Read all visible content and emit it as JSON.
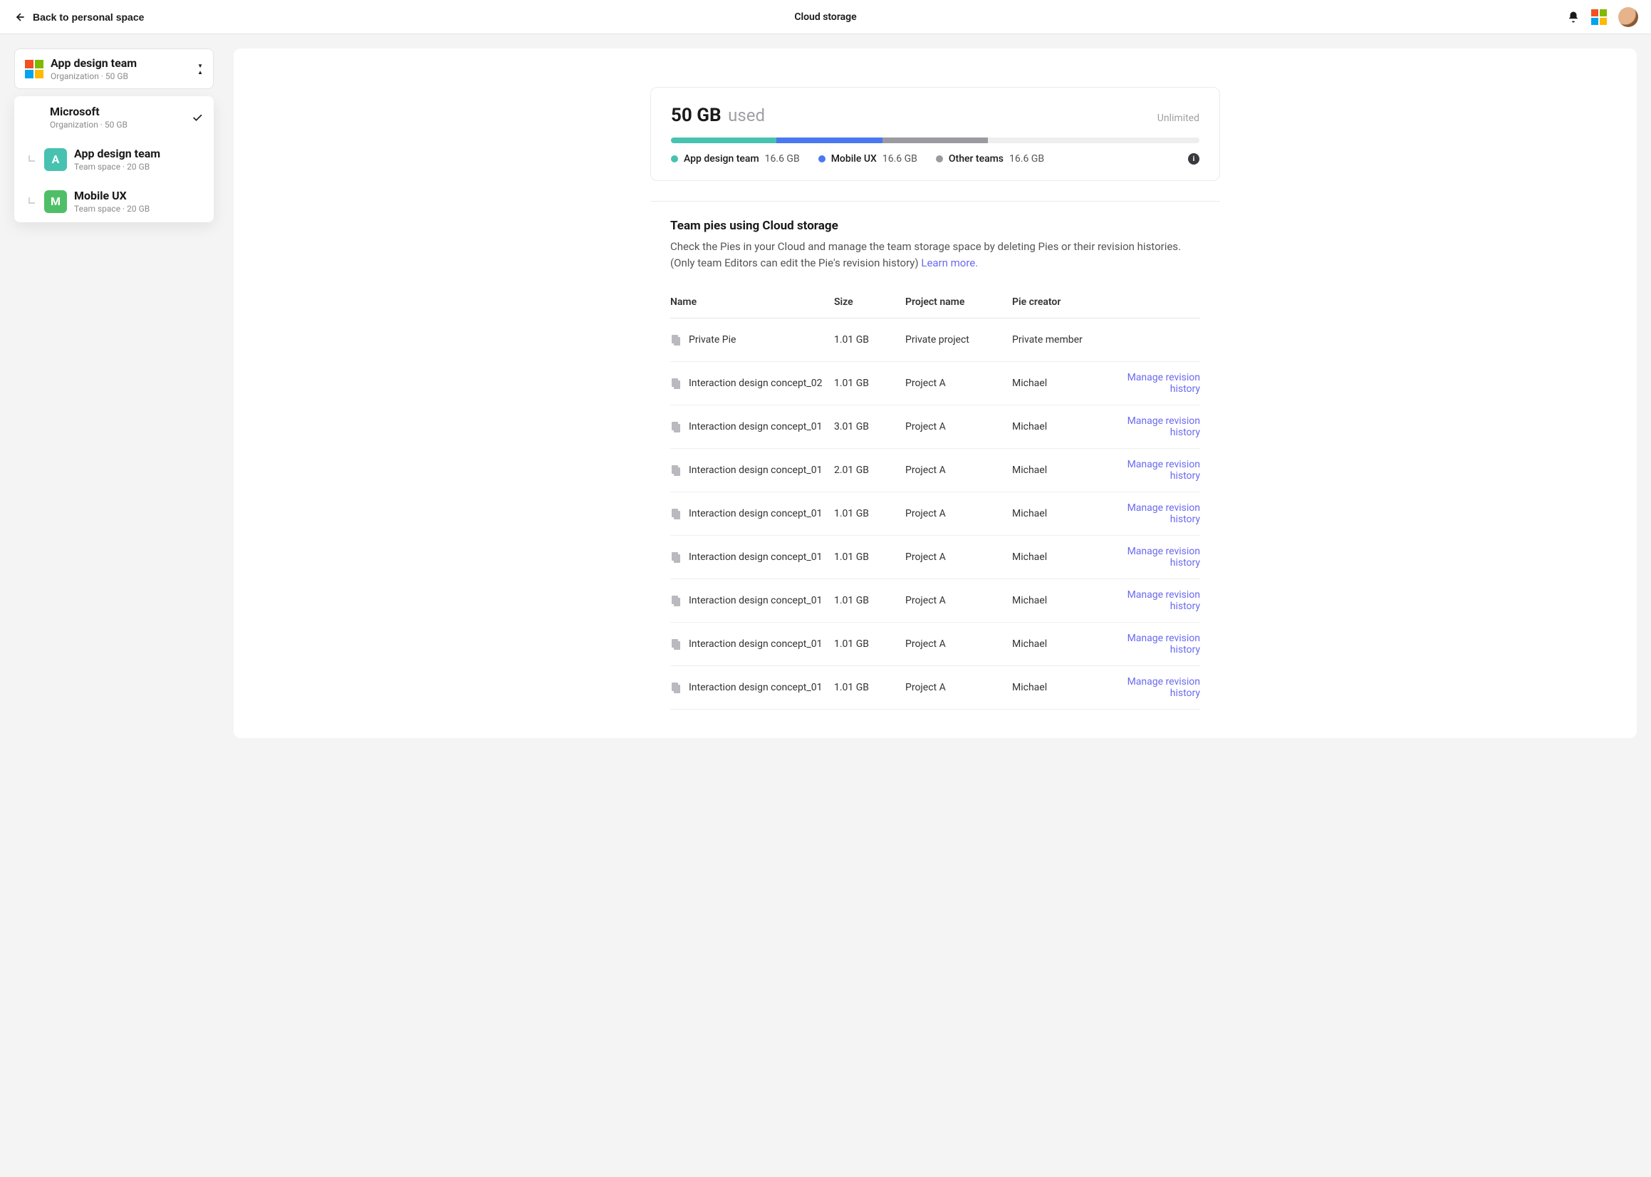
{
  "header": {
    "back_label": "Back to personal space",
    "title": "Cloud storage"
  },
  "sidebar": {
    "selected": {
      "title": "App design team",
      "subtitle": "Organization · 50 GB"
    },
    "dropdown": {
      "org": {
        "title": "Microsoft",
        "subtitle": "Organization · 50 GB"
      },
      "teams": [
        {
          "letter": "A",
          "title": "App design team",
          "subtitle": "Team space · 20 GB",
          "color": "cyan"
        },
        {
          "letter": "M",
          "title": "Mobile UX",
          "subtitle": "Team space · 20 GB",
          "color": "green"
        }
      ]
    }
  },
  "storage": {
    "amount": "50 GB",
    "used_label": "used",
    "cap_label": "Unlimited",
    "segments": [
      {
        "name": "App design team",
        "value": "16.6 GB",
        "pct": 20
      },
      {
        "name": "Mobile UX",
        "value": "16.6 GB",
        "pct": 20
      },
      {
        "name": "Other teams",
        "value": "16.6 GB",
        "pct": 20
      }
    ]
  },
  "pies": {
    "heading": "Team pies using Cloud storage",
    "description": "Check the Pies in your Cloud and manage the team storage space by deleting Pies or their revision histories. (Only team Editors can edit the Pie's revision history) ",
    "learn_more": "Learn more.",
    "columns": {
      "name": "Name",
      "size": "Size",
      "project": "Project name",
      "creator": "Pie creator"
    },
    "action_label": "Manage revision history",
    "rows": [
      {
        "name": "Private Pie",
        "size": "1.01 GB",
        "project": "Private project",
        "creator": "Private member",
        "private": true
      },
      {
        "name": "Interaction design concept_02",
        "size": "1.01 GB",
        "project": "Project A",
        "creator": "Michael"
      },
      {
        "name": "Interaction design concept_01",
        "size": "3.01 GB",
        "project": "Project A",
        "creator": "Michael"
      },
      {
        "name": "Interaction design concept_01",
        "size": "2.01 GB",
        "project": "Project A",
        "creator": "Michael"
      },
      {
        "name": "Interaction design concept_01",
        "size": "1.01 GB",
        "project": "Project A",
        "creator": "Michael"
      },
      {
        "name": "Interaction design concept_01",
        "size": "1.01 GB",
        "project": "Project A",
        "creator": "Michael"
      },
      {
        "name": "Interaction design concept_01",
        "size": "1.01 GB",
        "project": "Project A",
        "creator": "Michael"
      },
      {
        "name": "Interaction design concept_01",
        "size": "1.01 GB",
        "project": "Project A",
        "creator": "Michael"
      },
      {
        "name": "Interaction design concept_01",
        "size": "1.01 GB",
        "project": "Project A",
        "creator": "Michael"
      }
    ]
  }
}
